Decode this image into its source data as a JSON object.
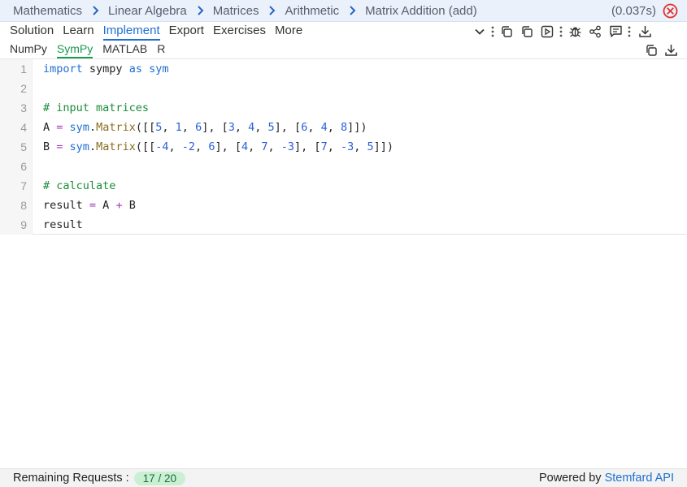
{
  "breadcrumb": {
    "items": [
      "Mathematics",
      "Linear Algebra",
      "Matrices",
      "Arithmetic",
      "Matrix Addition (add)"
    ]
  },
  "timing": "(0.037s)",
  "tabs": [
    "Solution",
    "Learn",
    "Implement",
    "Export",
    "Exercises",
    "More"
  ],
  "active_tab": "Implement",
  "subtabs": [
    "NumPy",
    "SymPy",
    "MATLAB",
    "R"
  ],
  "active_subtab": "SymPy",
  "colors": {
    "accent": "#1f6fd1",
    "active_subtab": "#1a9a4e",
    "close": "#e0312e",
    "breadcrumb_bg": "#eaf1fb",
    "badge_bg": "#c9f0d3"
  },
  "code": {
    "line_numbers": [
      "1",
      "2",
      "3",
      "4",
      "5",
      "6",
      "7",
      "8",
      "9"
    ],
    "lines": [
      "import sympy as sym",
      "",
      "# input matrices",
      "A = sym.Matrix([[5, 1, 6], [3, 4, 5], [6, 4, 8]])",
      "B = sym.Matrix([[-4, -2, 6], [4, 7, -3], [7, -3, 5]])",
      "",
      "# calculate",
      "result = A + B",
      "result"
    ]
  },
  "footer": {
    "remaining_label": "Remaining Requests :",
    "remaining_value": "17 / 20",
    "powered_prefix": "Powered by",
    "powered_link": "Stemfard API"
  },
  "icons": [
    "chevron-down-icon",
    "kebab-icon",
    "copy-icon",
    "copy-icon",
    "play-icon",
    "kebab-icon",
    "bug-icon",
    "share-icon",
    "comment-icon",
    "kebab-icon",
    "download-icon",
    "close-icon",
    "copy-icon",
    "download-icon"
  ]
}
